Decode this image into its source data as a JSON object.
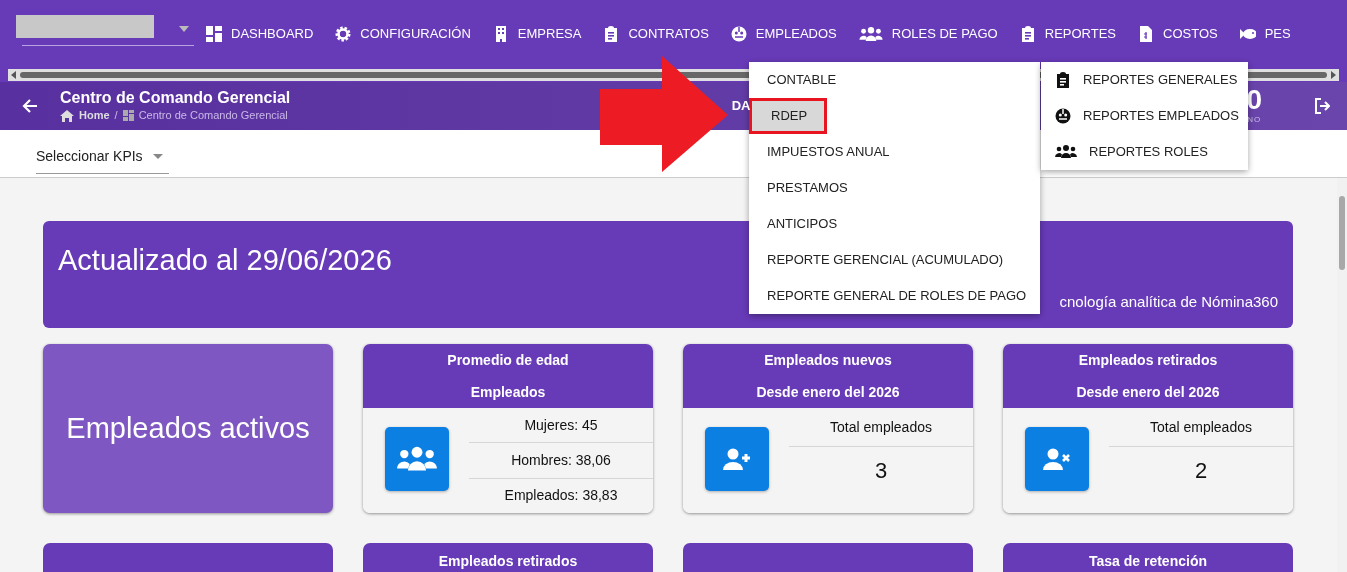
{
  "nav": {
    "items": [
      {
        "label": "DASHBOARD"
      },
      {
        "label": "CONFIGURACIÓN"
      },
      {
        "label": "EMPRESA"
      },
      {
        "label": "CONTRATOS"
      },
      {
        "label": "EMPLEADOS"
      },
      {
        "label": "ROLES DE PAGO"
      },
      {
        "label": "REPORTES"
      },
      {
        "label": "COSTOS"
      },
      {
        "label": "PES"
      }
    ]
  },
  "header": {
    "title": "Centro de Comando Gerencial",
    "breadcrumb": [
      {
        "label": "Home"
      },
      {
        "label": "Centro de Comando Gerencial"
      }
    ],
    "breadcrumb_separator": "/",
    "help_label": "DA",
    "stat_value": "0",
    "stat_caption": "NO"
  },
  "kpi_select": {
    "value": "Seleccionar KPIs"
  },
  "banner": {
    "title": "Actualizado al 29/06/2026",
    "caption": "cnología analítica de Nómina360"
  },
  "cards": [
    {
      "kind": "hero",
      "title": "Empleados activos"
    },
    {
      "kind": "multi",
      "title": "Promedio de edad",
      "subtitle": "Empleados",
      "stats": [
        "Mujeres: 45",
        "Hombres: 38,06",
        "Empleados: 38,83"
      ]
    },
    {
      "kind": "single",
      "title": "Empleados nuevos",
      "subtitle": "Desde enero del 2026",
      "label": "Total empleados",
      "value": "3"
    },
    {
      "kind": "single",
      "title": "Empleados retirados",
      "subtitle": "Desde enero del 2026",
      "label": "Total empleados",
      "value": "2"
    }
  ],
  "cards_row2": [
    {
      "kind": "blank"
    },
    {
      "kind": "titled",
      "title": "Empleados retirados"
    },
    {
      "kind": "blank"
    },
    {
      "kind": "titled",
      "title": "Tasa de retención"
    }
  ],
  "empleados_menu": {
    "items": [
      {
        "label": "CONTABLE",
        "selected": false
      },
      {
        "label": "RDEP",
        "selected": true
      },
      {
        "label": "IMPUESTOS ANUAL",
        "selected": false
      },
      {
        "label": "PRESTAMOS",
        "selected": false
      },
      {
        "label": "ANTICIPOS",
        "selected": false
      },
      {
        "label": "REPORTE GERENCIAL (ACUMULADO)",
        "selected": false
      },
      {
        "label": "REPORTE GENERAL DE ROLES DE PAGO",
        "selected": false
      }
    ]
  },
  "reportes_menu": {
    "items": [
      {
        "label": "REPORTES GENERALES"
      },
      {
        "label": "REPORTES EMPLEADOS"
      },
      {
        "label": "REPORTES ROLES"
      }
    ]
  },
  "annotation": {
    "kind": "arrow"
  }
}
